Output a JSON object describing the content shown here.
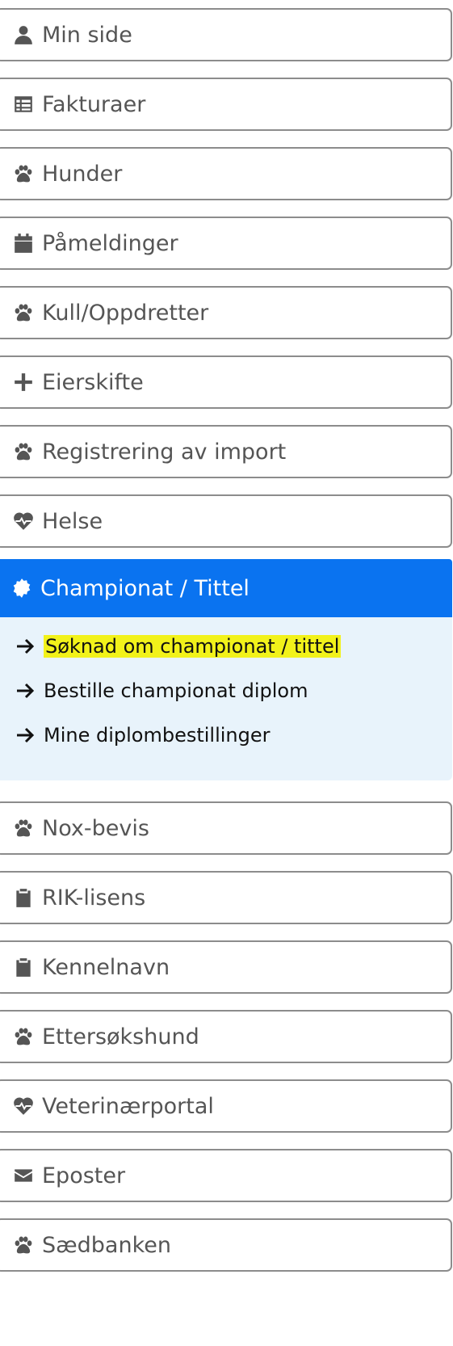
{
  "menu": {
    "items": [
      {
        "label": "Min side",
        "icon": "user-icon"
      },
      {
        "label": "Fakturaer",
        "icon": "list-icon"
      },
      {
        "label": "Hunder",
        "icon": "paw-icon"
      },
      {
        "label": "Påmeldinger",
        "icon": "calendar-icon"
      },
      {
        "label": "Kull/Oppdretter",
        "icon": "paw-icon"
      },
      {
        "label": "Eierskifte",
        "icon": "plus-icon"
      },
      {
        "label": "Registrering av import",
        "icon": "paw-icon"
      },
      {
        "label": "Helse",
        "icon": "heartbeat-icon"
      },
      {
        "label": "Championat / Tittel",
        "icon": "badge-icon"
      },
      {
        "label": "Nox-bevis",
        "icon": "paw-icon"
      },
      {
        "label": "RIK-lisens",
        "icon": "clipboard-icon"
      },
      {
        "label": "Kennelnavn",
        "icon": "clipboard-icon"
      },
      {
        "label": "Ettersøkshund",
        "icon": "paw-icon"
      },
      {
        "label": "Veterinærportal",
        "icon": "heartbeat-icon"
      },
      {
        "label": "Eposter",
        "icon": "envelope-icon"
      },
      {
        "label": "Sædbanken",
        "icon": "paw-icon"
      }
    ],
    "active_index": 8,
    "submenu": [
      {
        "label": "Søknad om championat / tittel",
        "icon": "arrow-right-icon",
        "highlighted": true
      },
      {
        "label": "Bestille championat diplom",
        "icon": "arrow-right-icon",
        "highlighted": false
      },
      {
        "label": "Mine diplombestillinger",
        "icon": "arrow-right-icon",
        "highlighted": false
      }
    ]
  },
  "colors": {
    "active_bg": "#0a73f0",
    "submenu_bg": "#e8f3fb",
    "highlight": "#f2f21a",
    "border": "#8c8c8c",
    "text": "#555555"
  }
}
